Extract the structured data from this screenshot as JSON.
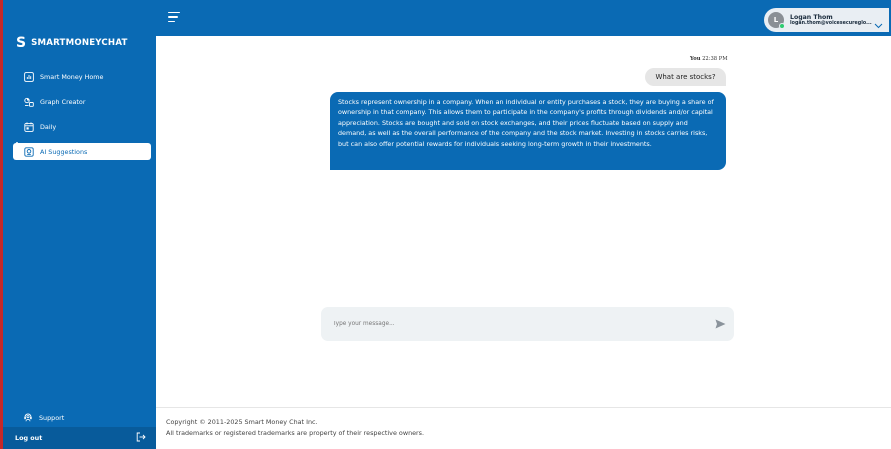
{
  "brand": {
    "mark": "S",
    "name": "SMARTMONEYCHAT"
  },
  "sidebar": {
    "items": [
      {
        "label": "Smart Money Home",
        "icon": "chart-icon"
      },
      {
        "label": "Graph Creator",
        "icon": "graph-icon"
      },
      {
        "label": "Daily",
        "icon": "calendar-icon"
      },
      {
        "label": "AI Suggestions",
        "icon": "ai-icon",
        "active": true
      }
    ],
    "support_label": "Support",
    "logout_label": "Log out"
  },
  "user": {
    "initial": "L",
    "name": "Logan Thom",
    "email": "logan.thom@voicesecureglo..."
  },
  "chat": {
    "user_message": {
      "sender": "You",
      "time": " 22:38 PM",
      "text": "What are stocks?"
    },
    "ai_message": {
      "text": "Stocks represent ownership in a company. When an individual or entity purchases a stock, they are buying a share of ownership in that company. This allows them to participate in the company's profits through dividends and/or capital appreciation. Stocks are bought and sold on stock exchanges, and their prices fluctuate based on supply and demand, as well as the overall performance of the company and the stock market. Investing in stocks carries risks, but can also offer potential rewards for individuals seeking long-term growth in their investments."
    },
    "input_placeholder": "Type your message..."
  },
  "footer": {
    "copyright": "Copyright © 2011-2025 Smart Money Chat Inc.",
    "trademark": "All trademarks or registered trademarks are property of their respective owners."
  },
  "colors": {
    "primary": "#0a6ab4",
    "sidebar_edge": "#c62828",
    "online": "#2ecc71"
  }
}
